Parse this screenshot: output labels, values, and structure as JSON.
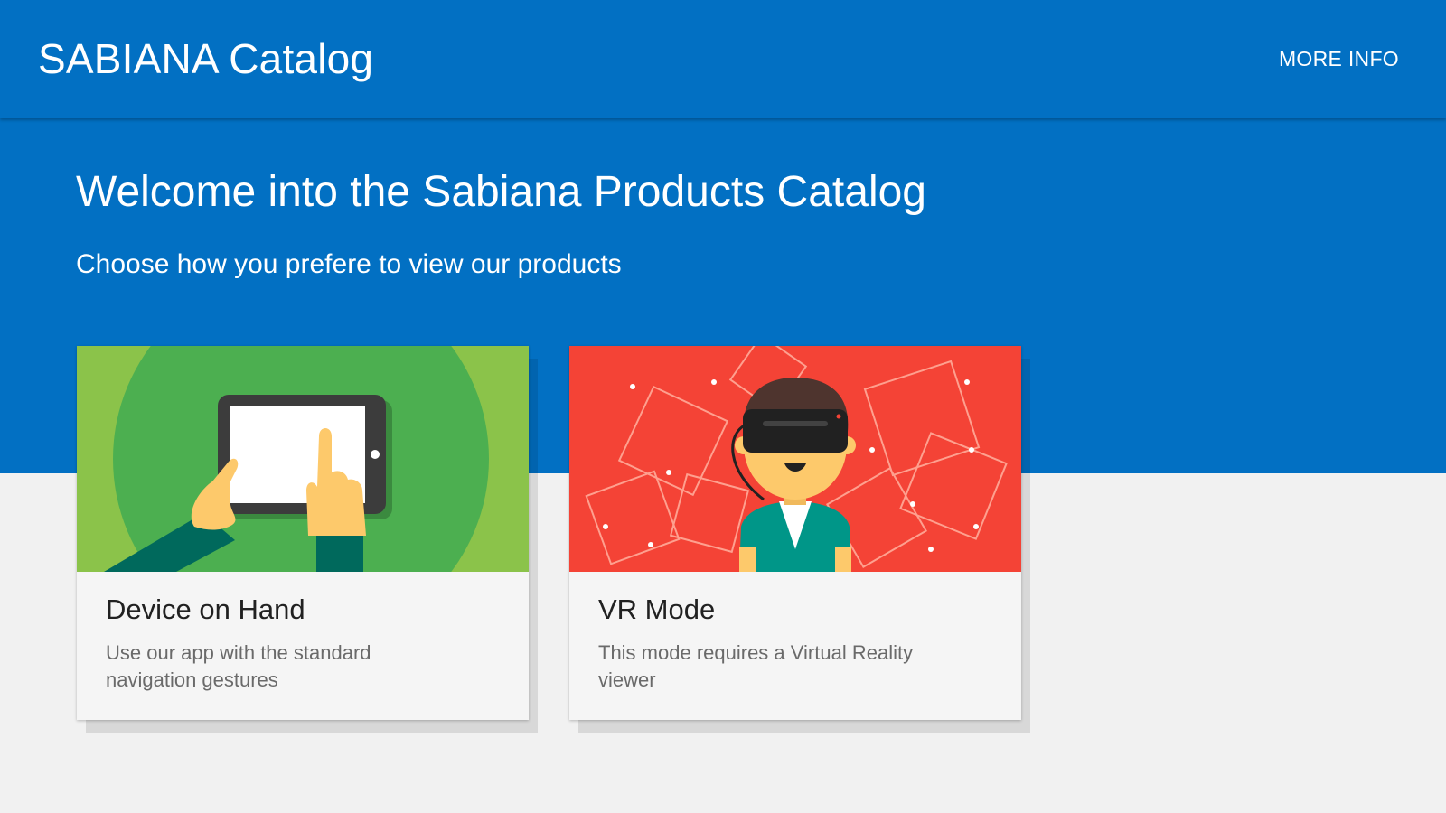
{
  "header": {
    "title": "SABIANA Catalog",
    "more_info_label": "MORE INFO"
  },
  "hero": {
    "heading": "Welcome into the Sabiana Products Catalog",
    "subheading": "Choose how you prefere to view our products"
  },
  "cards": [
    {
      "title": "Device on Hand",
      "description": "Use our app with the standard navigation gestures",
      "illustration": "hands-holding-tablet",
      "accent": "#8bc34a"
    },
    {
      "title": "VR Mode",
      "description": "This mode requires a Virtual Reality viewer",
      "illustration": "person-wearing-vr-headset",
      "accent": "#f44336"
    }
  ],
  "colors": {
    "primary": "#0270c3",
    "background": "#f1f1f1",
    "card": "#f5f5f5"
  }
}
